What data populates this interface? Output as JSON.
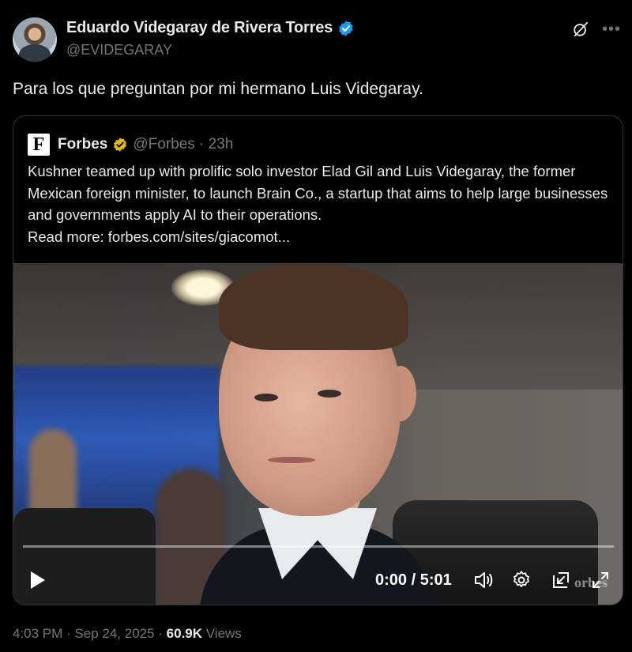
{
  "author": {
    "display_name": "Eduardo Videgaray de Rivera Torres",
    "handle": "@EVIDEGARAY",
    "verified_color": "#1d9bf0"
  },
  "tweet": {
    "text": "Para los que preguntan por mi hermano Luis Videgaray."
  },
  "quoted": {
    "logo_letter": "F",
    "name": "Forbes",
    "verified_color": "#e2b719",
    "handle_time": "@Forbes · 23h",
    "text": "Kushner teamed up with prolific solo investor Elad Gil and Luis Videgaray, the former Mexican foreign minister, to launch Brain Co., a startup that aims to help large businesses and governments apply AI to their operations.",
    "read_more": "Read more: forbes.com/sites/giacomot...",
    "video": {
      "time": "0:00 / 5:01",
      "watermark": "orbes",
      "progress": 0
    }
  },
  "meta": {
    "timestamp": "4:03 PM · Sep 24, 2025 · ",
    "views_count": "60.9K",
    "views_label": " Views"
  },
  "icons": [
    "grok-icon",
    "more-icon",
    "play-icon",
    "volume-icon",
    "settings-icon",
    "pip-icon",
    "fullscreen-icon"
  ]
}
